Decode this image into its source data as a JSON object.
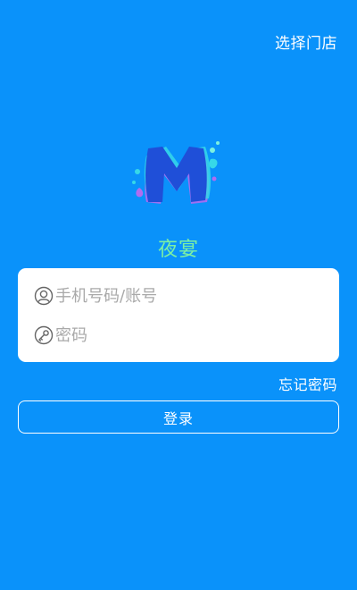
{
  "header": {
    "select_store_label": "选择门店"
  },
  "app": {
    "name": "夜宴"
  },
  "login_form": {
    "phone_placeholder": "手机号码/账号",
    "phone_value": "",
    "password_placeholder": "密码",
    "password_value": "",
    "phone_icon": "user-icon",
    "password_icon": "key-icon"
  },
  "actions": {
    "forgot_password_label": "忘记密码",
    "login_label": "登录"
  },
  "colors": {
    "background": "#0A92FA",
    "card": "#FFFFFF",
    "app_name": "#7CF0A3",
    "placeholder": "#A9A9A9"
  }
}
